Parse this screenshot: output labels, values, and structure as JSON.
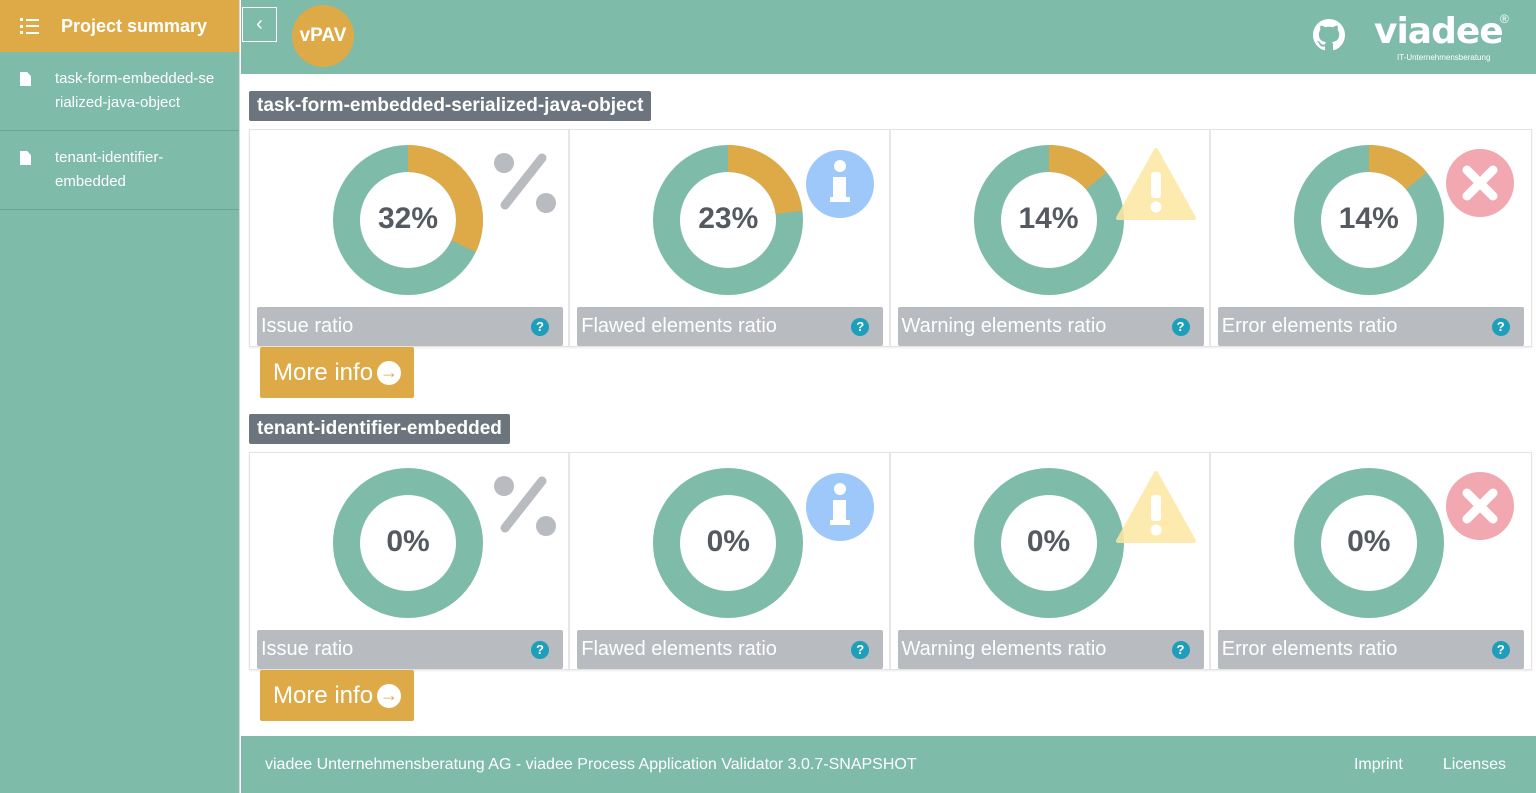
{
  "sidebar": {
    "title": "Project summary",
    "items": [
      {
        "label": "task-form-embedded-serialized-java-object"
      },
      {
        "label": "tenant-identifier-embedded"
      }
    ]
  },
  "header": {
    "collapse_label": "‹",
    "logo": "vPAV",
    "brand": "viadee",
    "brand_mark": "®",
    "brand_sub": "IT-Unternehmensberatung"
  },
  "colors": {
    "accent": "#deaa48",
    "teal": "#7ebba8",
    "info": "#9ec8f9",
    "warning": "#fde7a0",
    "error": "#f2a8b0",
    "help": "#1d9ebb"
  },
  "projects": [
    {
      "title": "task-form-embedded-serialized-java-object",
      "cards": [
        {
          "label": "Issue ratio",
          "value": 32,
          "value_text": "32%",
          "icon": "percent-icon"
        },
        {
          "label": "Flawed elements ratio",
          "value": 23,
          "value_text": "23%",
          "icon": "info-icon"
        },
        {
          "label": "Warning elements ratio",
          "value": 14,
          "value_text": "14%",
          "icon": "warning-icon"
        },
        {
          "label": "Error elements ratio",
          "value": 14,
          "value_text": "14%",
          "icon": "error-icon"
        }
      ],
      "more_label": "More info"
    },
    {
      "title": "tenant-identifier-embedded",
      "cards": [
        {
          "label": "Issue ratio",
          "value": 0,
          "value_text": "0%",
          "icon": "percent-icon"
        },
        {
          "label": "Flawed elements ratio",
          "value": 0,
          "value_text": "0%",
          "icon": "info-icon"
        },
        {
          "label": "Warning elements ratio",
          "value": 0,
          "value_text": "0%",
          "icon": "warning-icon"
        },
        {
          "label": "Error elements ratio",
          "value": 0,
          "value_text": "0%",
          "icon": "error-icon"
        }
      ],
      "more_label": "More info"
    }
  ],
  "help_symbol": "?",
  "footer": {
    "text": "viadee Unternehmensberatung AG - viadee Process Application Validator 3.0.7-SNAPSHOT",
    "imprint": "Imprint",
    "licenses": "Licenses"
  }
}
